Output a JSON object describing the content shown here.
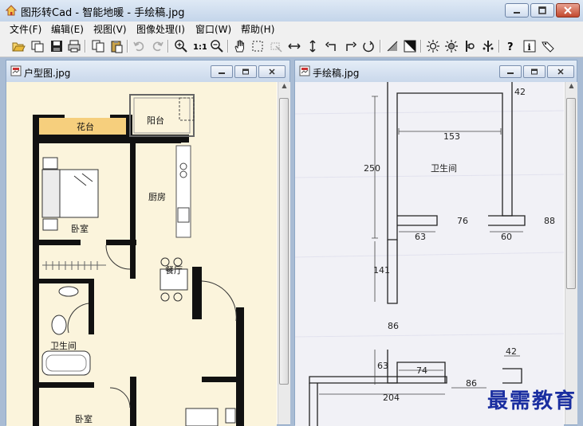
{
  "app": {
    "title": "图形转Cad - 智能地暖 - 手绘稿.jpg"
  },
  "menu": [
    "文件(F)",
    "编辑(E)",
    "视图(V)",
    "图像处理(I)",
    "窗口(W)",
    "帮助(H)"
  ],
  "toolbar_icons": [
    "open-icon",
    "new-window-icon",
    "save-icon",
    "print-icon",
    "copy-icon",
    "paste-icon",
    "undo-icon",
    "redo-icon",
    "zoom-in-icon",
    "actual-size-icon",
    "zoom-out-icon",
    "hand-pan-icon",
    "select-rect-icon",
    "crop-icon",
    "flip-horizontal-icon",
    "flip-vertical-icon",
    "rotate-left-icon",
    "rotate-right-icon",
    "rotate-reset-icon",
    "threshold-icon",
    "invert-icon",
    "brightness-icon",
    "contrast-icon",
    "sharpen-icon",
    "denoise-icon",
    "help-icon",
    "info-icon",
    "tag-icon"
  ],
  "windows": {
    "left": {
      "title": "户型图.jpg",
      "rooms": [
        "花台",
        "阳台",
        "卧室",
        "厨房",
        "餐厅",
        "卫生间",
        "卧室"
      ]
    },
    "right": {
      "title": "手绘稿.jpg",
      "room_label": "卫生间",
      "dimensions": [
        "42",
        "153",
        "250",
        "76",
        "88",
        "63",
        "60",
        "141",
        "86",
        "63",
        "74",
        "86",
        "204",
        "42"
      ]
    }
  },
  "watermark": "最需教育"
}
